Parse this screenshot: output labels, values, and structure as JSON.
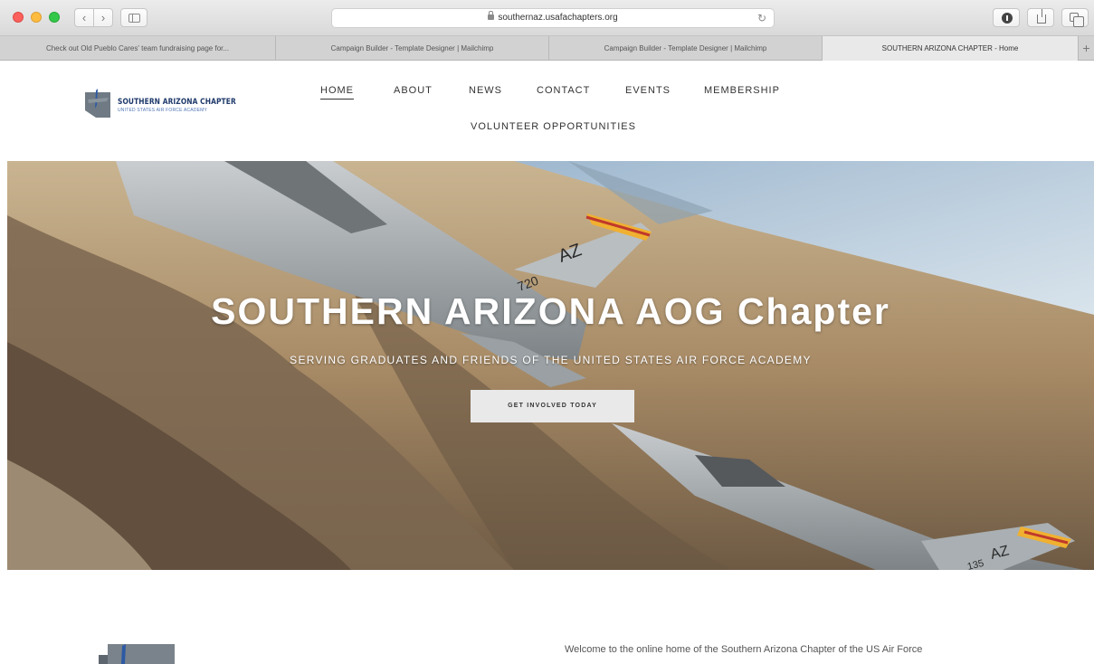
{
  "browser": {
    "url": "southernaz.usafachapters.org",
    "tabs": [
      {
        "label": "Check out Old Pueblo Cares' team fundraising page for..."
      },
      {
        "label": "Campaign Builder - Template Designer | Mailchimp"
      },
      {
        "label": "Campaign Builder - Template Designer | Mailchimp"
      },
      {
        "label": "SOUTHERN ARIZONA CHAPTER - Home"
      }
    ],
    "new_tab_label": "+"
  },
  "site": {
    "logo": {
      "title": "SOUTHERN ARIZONA CHAPTER",
      "subtitle": "UNITED STATES AIR FORCE ACADEMY"
    },
    "nav": [
      {
        "label": "HOME"
      },
      {
        "label": "ABOUT"
      },
      {
        "label": "NEWS"
      },
      {
        "label": "CONTACT"
      },
      {
        "label": "EVENTS"
      },
      {
        "label": "MEMBERSHIP"
      },
      {
        "label": "VOLUNTEER OPPORTUNITIES"
      }
    ],
    "hero": {
      "title": "SOUTHERN ARIZONA AOG Chapter",
      "subtitle": "SERVING GRADUATES AND FRIENDS OF THE UNITED STATES AIR FORCE ACADEMY",
      "cta_label": "GET INVOLVED TODAY",
      "jet1_tail": "AZ",
      "jet1_serial": "720",
      "jet2_tail": "AZ",
      "jet2_serial": "135"
    },
    "welcome_text": "Welcome to the online home of the Southern Arizona Chapter of the US Air Force"
  },
  "colors": {
    "brand_navy": "#1f3a6b",
    "cta_bg": "#e9e9e9"
  }
}
